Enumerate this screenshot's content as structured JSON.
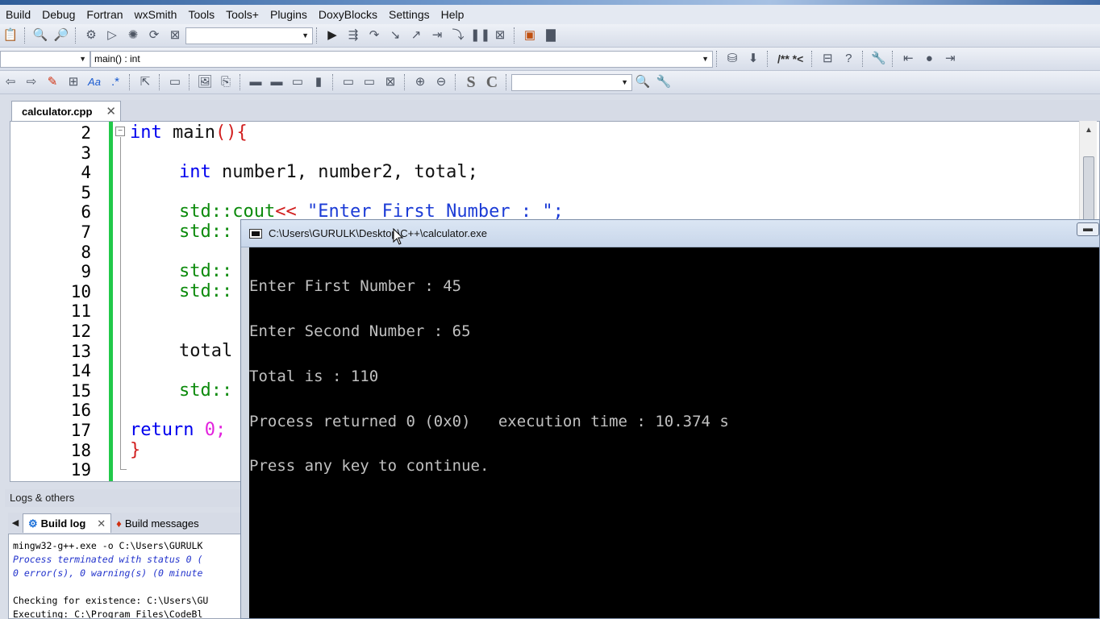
{
  "menu": [
    "Build",
    "Debug",
    "Fortran",
    "wxSmith",
    "Tools",
    "Tools+",
    "Plugins",
    "DoxyBlocks",
    "Settings",
    "Help"
  ],
  "toolbar2": {
    "function_combo": "main() : int",
    "comment_label": "/** *<"
  },
  "toolbar3": {
    "s_label": "S",
    "c_label": "C"
  },
  "editor": {
    "tab_name": "calculator.cpp",
    "line_numbers": [
      "2",
      "3",
      "4",
      "5",
      "6",
      "7",
      "8",
      "9",
      "10",
      "11",
      "12",
      "13",
      "14",
      "15",
      "16",
      "17",
      "18",
      "19"
    ],
    "code": {
      "l2_kw": "int",
      "l2_id": " main",
      "l2_op": "(){",
      "l4_kw": "int",
      "l4_rest": " number1, number2, total;",
      "l6_std": "std::",
      "l6_cout": "cout",
      "l6_op": "<<",
      "l6_str": " \"Enter First Number : \";",
      "l7": "std::",
      "l9": "std::",
      "l10": "std::",
      "l13": "total",
      "l15": "std::",
      "l17_kw": "return",
      "l17_num": " 0;",
      "l18": "}"
    }
  },
  "logs": {
    "header": "Logs & others",
    "tabs": [
      "Build log",
      "Build messages"
    ],
    "lines": [
      "mingw32-g++.exe  -o C:\\Users\\GURULK",
      "Process terminated with status 0 (",
      "0 error(s), 0 warning(s) (0 minute",
      "",
      "Checking for existence: C:\\Users\\GU",
      "Executing: C:\\Program Files\\CodeBl"
    ]
  },
  "console": {
    "title": "C:\\Users\\GURULK\\Desktop\\C++\\calculator.exe",
    "lines": [
      "Enter First Number : 45",
      "Enter Second Number : 65",
      "Total is : 110",
      "Process returned 0 (0x0)   execution time : 10.374 s",
      "Press any key to continue."
    ]
  }
}
